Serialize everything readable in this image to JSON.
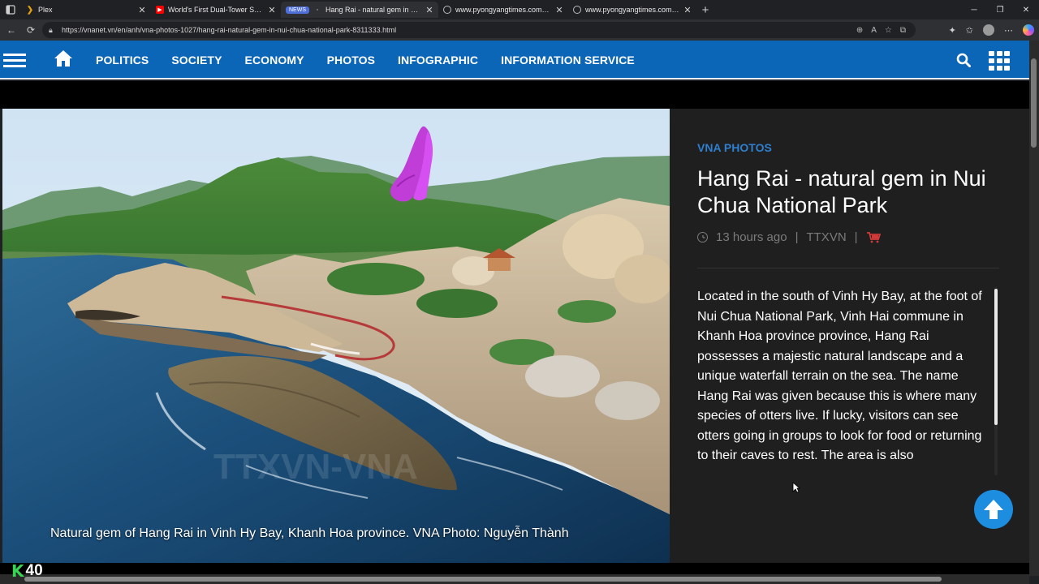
{
  "browser": {
    "tabs": [
      {
        "title": "Plex",
        "favicon": "plex-icon",
        "active": false
      },
      {
        "title": "World's First Dual-Tower Solar Th",
        "favicon": "youtube-icon",
        "active": false
      },
      {
        "title": "Hang Rai - natural gem in Nui Ch",
        "favicon": "news-icon",
        "badge": "NEWS",
        "active": true
      },
      {
        "title": "www.pyongyangtimes.com.kp",
        "favicon": "globe-icon",
        "active": false
      },
      {
        "title": "www.pyongyangtimes.com.kp",
        "favicon": "globe-icon",
        "active": false
      }
    ],
    "url": "https://vnanet.vn/en/anh/vna-photos-1027/hang-rai-natural-gem-in-nui-chua-national-park-8311333.html"
  },
  "nav": {
    "items": [
      "POLITICS",
      "SOCIETY",
      "ECONOMY",
      "PHOTOS",
      "INFOGRAPHIC",
      "INFORMATION SERVICE"
    ],
    "bar_color": "#0c66b7"
  },
  "article": {
    "category": "VNA PHOTOS",
    "title": "Hang Rai - natural gem in Nui Chua National Park",
    "time": "13 hours ago",
    "source": "TTXVN",
    "separator": "|",
    "summary": "Located in the south of Vinh Hy Bay, at the foot of Nui Chua National Park, Vinh Hai commune in Khanh Hoa province province, Hang Rai possesses a majestic natural landscape and a unique waterfall terrain on the sea. The name Hang Rai was given because this is where many species of otters live. If lucky, visitors can see otters going in groups to look for food or returning to their caves to rest. The area is also",
    "photo_caption": "Natural gem of Hang Rai in Vinh Hy Bay, Khanh Hoa province. VNA Photo: Nguyễn Thành",
    "watermark": "TTXVN-VNA"
  },
  "overlay": {
    "counter_letter": "K",
    "counter_value": "40"
  }
}
